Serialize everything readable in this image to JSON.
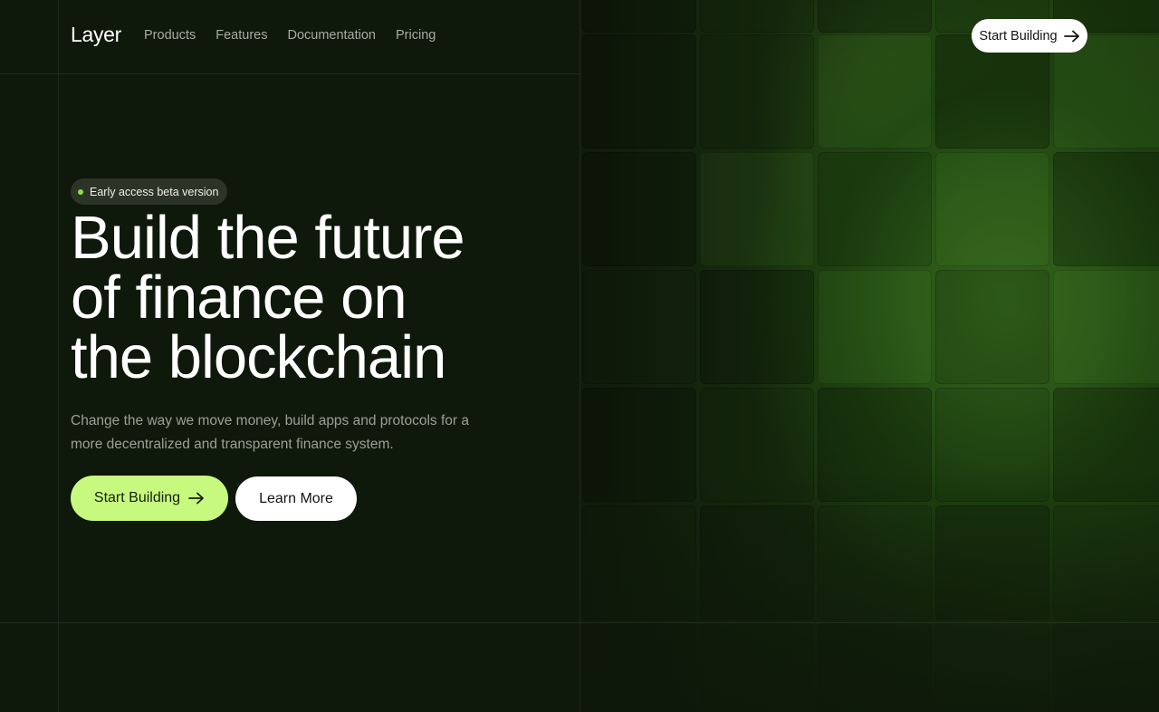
{
  "nav": {
    "logo": "Layer",
    "links": [
      {
        "label": "Products"
      },
      {
        "label": "Features"
      },
      {
        "label": "Documentation"
      },
      {
        "label": "Pricing"
      }
    ],
    "cta_label": "Start Building",
    "cta_icon": "arrow-right-icon"
  },
  "hero": {
    "badge_text": "Early access beta version",
    "headline_lines": [
      "Build the future",
      "of finance on",
      "the blockchain"
    ],
    "subtext": "Change the way we move money, build apps and protocols for a more decentralized and transparent finance system.",
    "primary_button": {
      "label": "Start Building",
      "icon": "arrow-right-icon"
    },
    "secondary_button": {
      "label": "Learn More"
    }
  },
  "colors": {
    "background": "#0e180b",
    "accent": "#c8f97f",
    "badge_dot": "#8be04a",
    "tile_green": "#2a5517"
  }
}
